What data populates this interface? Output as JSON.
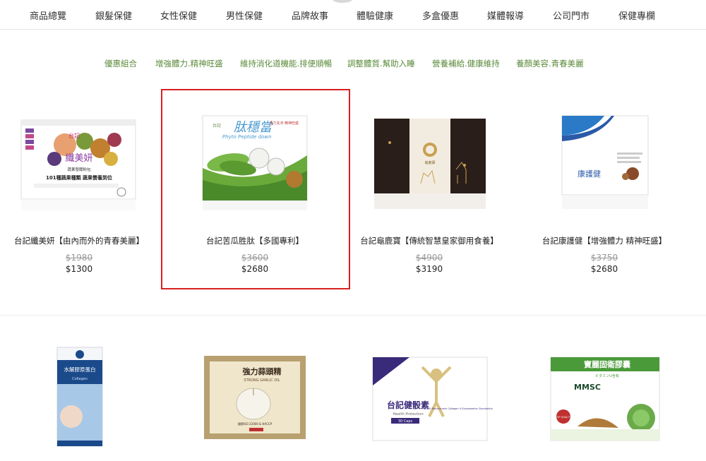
{
  "nav": {
    "items": [
      {
        "label": "商品總覽"
      },
      {
        "label": "銀髮保健"
      },
      {
        "label": "女性保健"
      },
      {
        "label": "男性保健"
      },
      {
        "label": "品牌故事"
      },
      {
        "label": "體驗健康"
      },
      {
        "label": "多盒優惠"
      },
      {
        "label": "媒體報導"
      },
      {
        "label": "公司門市"
      },
      {
        "label": "保健專欄"
      }
    ]
  },
  "subnav": {
    "items": [
      {
        "label": "優惠組合"
      },
      {
        "label": "增強體力.精神旺盛"
      },
      {
        "label": "維持消化道機能.排便順暢"
      },
      {
        "label": "調整體質.幫助入睡"
      },
      {
        "label": "營養補給.健康維持"
      },
      {
        "label": "養顏美容.青春美麗"
      }
    ]
  },
  "products": [
    {
      "name": "台記纖美妍【由內而外的青春美麗】",
      "old_price": "$1980",
      "price": "$1300",
      "box_text": {
        "brand": "台記",
        "title": "纖美妍",
        "line1": "蔬果發酵粉包",
        "line2": "101種蔬果種類 蔬果營養到位"
      }
    },
    {
      "name": "台記苦瓜胜肽【多國專利】",
      "old_price": "$3600",
      "price": "$2680",
      "box_text": {
        "brand": "台記",
        "title": "肽穩當",
        "subtitle": "Phyto Peptide down",
        "tagline": "活力充沛 精神旺盛"
      }
    },
    {
      "name": "台記龜鹿寶【傳統智慧皇家御用食養】",
      "old_price": "$4900",
      "price": "$3190",
      "box_text": {
        "title": "龜鹿寶"
      }
    },
    {
      "name": "台記康護健【增強體力 精神旺盛】",
      "old_price": "$3750",
      "price": "$2680",
      "box_text": {
        "title": "康護健"
      }
    }
  ],
  "row2_products": [
    {
      "box_text": {
        "title": "水解膠原蛋白",
        "sub": "Collagen"
      }
    },
    {
      "box_text": {
        "title": "強力蒜頭精",
        "sub": "STRONG GARLIC OIL",
        "cert": "國際ISO 22000 & HACCP"
      }
    },
    {
      "box_text": {
        "title": "台記健骰素",
        "sub": "Health Protection",
        "count": "30 Caps",
        "ingredients": "UC-II Biocurcumin Collagen II Glucosamine Chondroitin"
      }
    },
    {
      "box_text": {
        "title": "寶麗固衛膠囊",
        "sub": "ビタミンU含有",
        "mark": "MMSC",
        "badge": "TOP QUALITY"
      }
    }
  ],
  "colors": {
    "accent_green": "#5a8a3a",
    "highlight_red": "#d82020"
  }
}
